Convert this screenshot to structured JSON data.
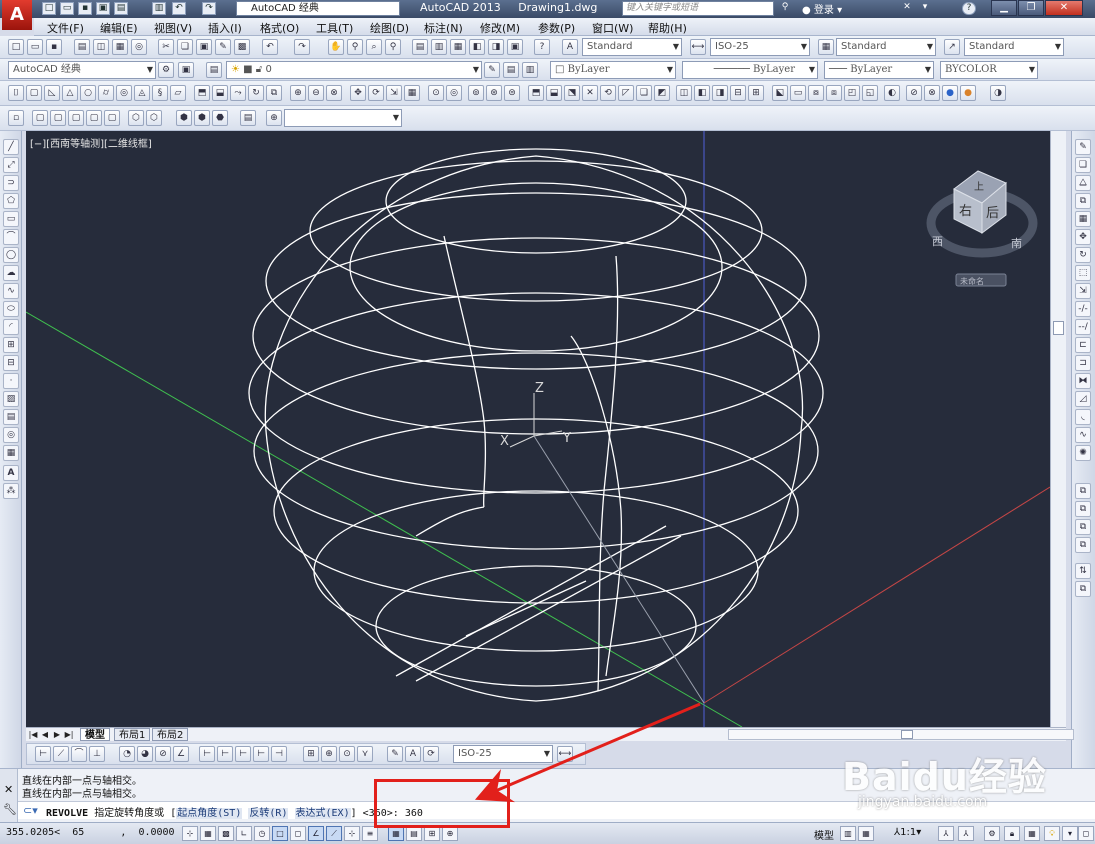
{
  "title_bar": {
    "logo_letter": "A",
    "workspace_combo": "AutoCAD 经典",
    "app_name": "AutoCAD 2013",
    "file_name": "Drawing1.dwg",
    "search_placeholder": "键入关键字或短语",
    "login_label": "登录",
    "help_label": "?"
  },
  "menu": [
    "文件(F)",
    "编辑(E)",
    "视图(V)",
    "插入(I)",
    "格式(O)",
    "工具(T)",
    "绘图(D)",
    "标注(N)",
    "修改(M)",
    "参数(P)",
    "窗口(W)",
    "帮助(H)"
  ],
  "styles_toolbar": {
    "text_style": "Standard",
    "dim_style": "ISO-25",
    "table_style": "Standard",
    "multileader_style": "Standard"
  },
  "layers_toolbar": {
    "workspace": "AutoCAD 经典",
    "current_layer": "0",
    "color": "ByLayer",
    "linetype": "ByLayer",
    "lineweight": "ByLayer",
    "plot_style": "BYCOLOR"
  },
  "viewport": {
    "label": "[−][西南等轴测][二维线框]",
    "ucs": {
      "x": "X",
      "y": "Y",
      "z": "Z"
    },
    "viewcube": {
      "face_top": "上",
      "face_left": "右",
      "face_right": "后",
      "compass_w": "西",
      "compass_s": "南"
    },
    "ucs_menu": "未命名"
  },
  "layout_tabs": [
    "模型",
    "布局1",
    "布局2"
  ],
  "dim_toolbar": {
    "dim_style": "ISO-25"
  },
  "command": {
    "history": [
      "直线在内部一点与轴相交。",
      "直线在内部一点与轴相交。"
    ],
    "command_name": "REVOLVE",
    "prompt": "指定旋转角度或",
    "options": [
      {
        "label": "起点角度",
        "key": "ST"
      },
      {
        "label": "反转",
        "key": "R"
      },
      {
        "label": "表达式",
        "key": "EX"
      }
    ],
    "default": "<360>:",
    "input": "360"
  },
  "status": {
    "coords": "355.0205<  65      ,  0.0000",
    "model_label": "模型",
    "scale": "1:1"
  },
  "watermark": {
    "brand": "Baidu经验",
    "domain": "jingyan.baidu.com"
  },
  "colors": {
    "viewport_bg": "#262c3b",
    "wire": "#ffffff",
    "highlight": "#e2201b",
    "axis_red": "#c44646",
    "axis_green": "#3fbf4f",
    "axis_blue": "#5060d8"
  }
}
